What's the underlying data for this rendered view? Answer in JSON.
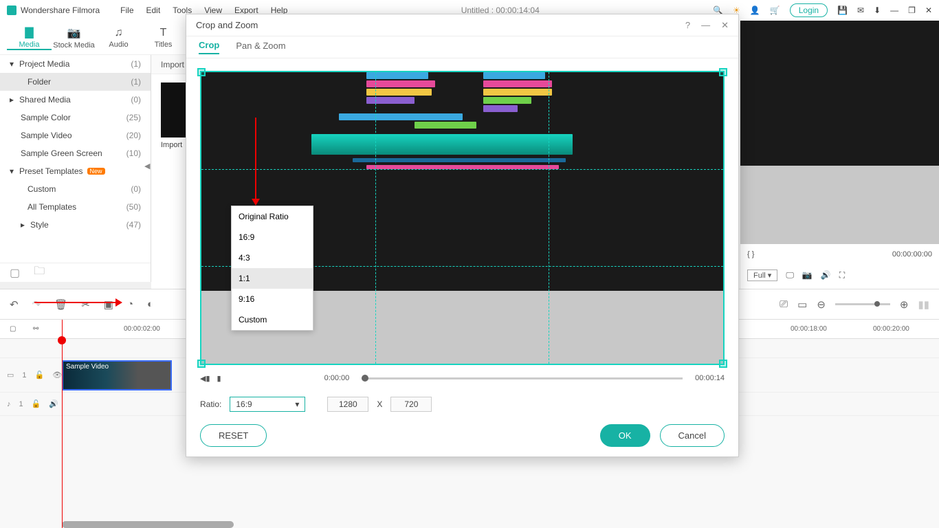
{
  "app": {
    "title": "Wondershare Filmora",
    "document": "Untitled : 00:00:14:04",
    "login": "Login"
  },
  "menus": [
    "File",
    "Edit",
    "Tools",
    "View",
    "Export",
    "Help"
  ],
  "tabs": [
    {
      "label": "Media",
      "icon": "🗀"
    },
    {
      "label": "Stock Media",
      "icon": "📷"
    },
    {
      "label": "Audio",
      "icon": "♫"
    },
    {
      "label": "Titles",
      "icon": "T"
    }
  ],
  "sidebar": {
    "items": [
      {
        "label": "Project Media",
        "count": "(1)",
        "chev": "▾"
      },
      {
        "label": "Folder",
        "count": "(1)",
        "sel": true,
        "indent": true
      },
      {
        "label": "Shared Media",
        "count": "(0)",
        "chev": "▸"
      },
      {
        "label": "Sample Color",
        "count": "(25)"
      },
      {
        "label": "Sample Video",
        "count": "(20)"
      },
      {
        "label": "Sample Green Screen",
        "count": "(10)"
      },
      {
        "label": "Preset Templates",
        "count": "",
        "chev": "▾",
        "badge": "New"
      },
      {
        "label": "Custom",
        "count": "(0)",
        "indent": true
      },
      {
        "label": "All Templates",
        "count": "(50)",
        "indent": true
      },
      {
        "label": "Style",
        "count": "(47)",
        "chev": "▸",
        "indent": true
      }
    ]
  },
  "import": {
    "header": "Import",
    "thumb_label": "Import"
  },
  "preview": {
    "markers": "{    }",
    "timecode": "00:00:00:00",
    "quality": "Full"
  },
  "timeline": {
    "ticks": [
      "00:00:02:00",
      "00:00:18:00",
      "00:00:20:00"
    ],
    "clip_label": "Sample Video",
    "video_track": "1",
    "audio_track": "1"
  },
  "modal": {
    "title": "Crop and Zoom",
    "tabs": [
      "Crop",
      "Pan & Zoom"
    ],
    "ratio_options": [
      "Original Ratio",
      "16:9",
      "4:3",
      "1:1",
      "9:16",
      "Custom"
    ],
    "time_start": "0:00:00",
    "time_end": "00:00:14",
    "ratio_label": "Ratio:",
    "ratio_value": "16:9",
    "width": "1280",
    "x": "X",
    "height": "720",
    "reset": "RESET",
    "ok": "OK",
    "cancel": "Cancel"
  }
}
